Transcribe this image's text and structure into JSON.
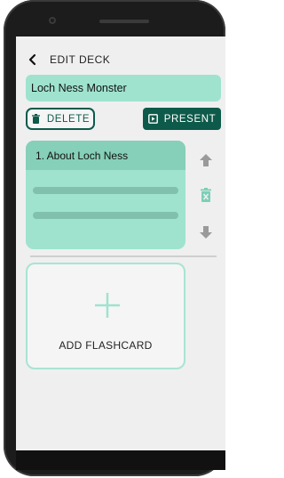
{
  "header": {
    "title": "EDIT DECK",
    "back_icon": "chevron-left-icon"
  },
  "deck": {
    "name": "Loch Ness Monster"
  },
  "actions": {
    "delete_label": "DELETE",
    "delete_icon": "trash-icon",
    "present_label": "PRESENT",
    "present_icon": "present-icon"
  },
  "cards": [
    {
      "title": "1. About Loch Ness"
    }
  ],
  "card_controls": [
    "arrow-up-icon",
    "delete-card-icon",
    "arrow-down-icon"
  ],
  "add_card": {
    "label": "ADD FLASHCARD",
    "icon": "plus-icon"
  },
  "colors": {
    "accent_light": "#9fe3cf",
    "accent_dark": "#0d5a4a",
    "background": "#efefef"
  }
}
